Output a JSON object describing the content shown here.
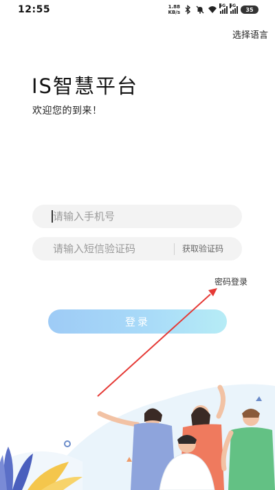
{
  "status_bar": {
    "time": "12:55",
    "net_speed_value": "1.88",
    "net_speed_unit": "KB/s",
    "signal1_label": "5G",
    "signal2_label": "5G",
    "battery": "35"
  },
  "header": {
    "language_link": "选择语言"
  },
  "main": {
    "title": "IS智慧平台",
    "subtitle": "欢迎您的到来！"
  },
  "form": {
    "phone_placeholder": "请输入手机号",
    "code_placeholder": "请输入短信验证码",
    "get_code_label": "获取验证码",
    "password_login_label": "密码登录",
    "login_button_label": "登录"
  },
  "colors": {
    "login_button": "#a8d6f8",
    "annotation_arrow": "#e53935",
    "input_background": "#f3f3f3"
  },
  "icons": [
    "bluetooth-icon",
    "mute-icon",
    "wifi-icon",
    "signal-icon",
    "battery-icon"
  ]
}
